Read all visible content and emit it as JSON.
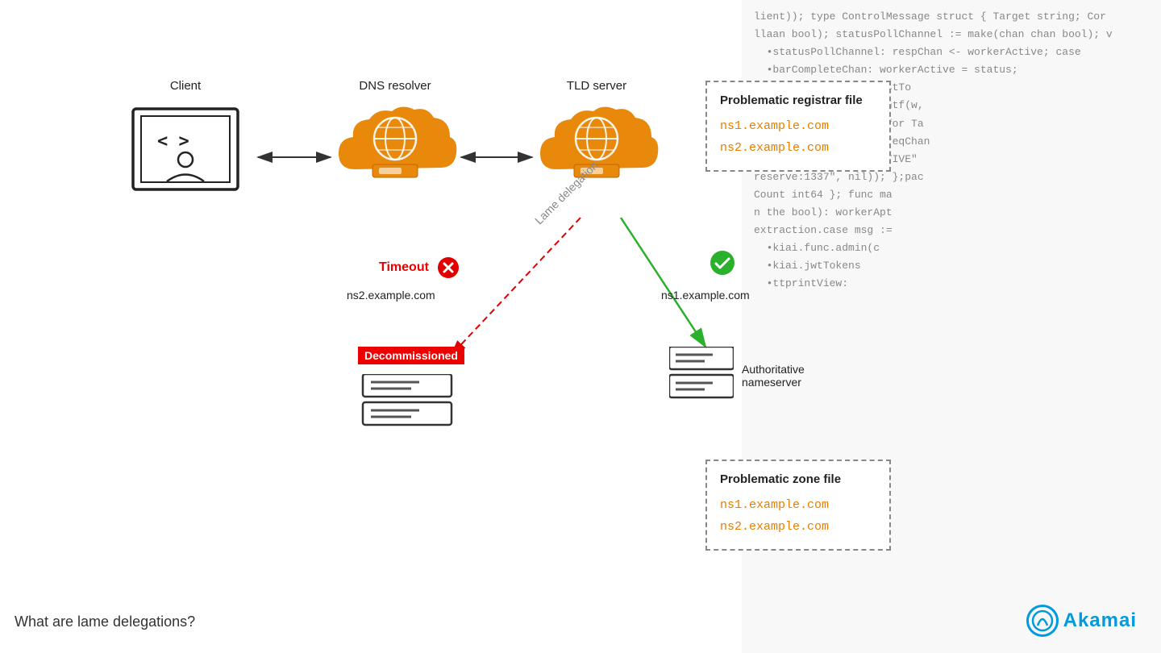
{
  "title": "What are lame delegations?",
  "client_label": "Client",
  "dns_label": "DNS resolver",
  "tld_label": "TLD server",
  "registrar_title": "Problematic registrar file",
  "zone_title": "Problematic zone file",
  "ns1": "ns1.example.com",
  "ns2": "ns2.example.com",
  "ns2_node_label": "ns2.example.com",
  "ns1_node_label": "ns1.example.com",
  "timeout_label": "Timeout",
  "lame_label": "Lame delegation",
  "decommissioned_label": "Decommissioned",
  "auth_label1": "Authoritative",
  "auth_label2": "nameserver",
  "akamai_text": "Akamai",
  "bottom_caption": "What are lame delegations?",
  "colors": {
    "orange": "#e8890c",
    "red": "#e00000",
    "green": "#2ab02a",
    "blue": "#009bde",
    "dark_dashed": "#999",
    "code_text": "#aaa"
  },
  "code_lines": [
    "lient)); type ControlMessage struct { Target string; Cor",
    "llaan bool); statusPollChannel := make(chan chan bool); v",
    "•statusPollChannel: respChan <- workerActive; case",
    "•barCompleteChan: workerActive = status;",
    "r *http.Request) { hostTo",
    "err != nil { fmt.Fprintf(w,",
    "ntrol message issued for Ta",
    "• *http.Request) { reqChan",
    "li: fmt.Fprint(w, \"ACTIVE\"",
    "reserve:1337\", nil)); };pac",
    "Count int64 }; func ma",
    "n the bool): workerApt",
    "extraction.case msg :=",
    "•kiai.func.admin(c",
    "•kiai.jwtTokens",
    "•ttprintView:",
    ""
  ]
}
